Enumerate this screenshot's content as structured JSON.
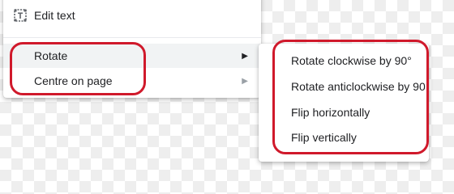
{
  "context_menu": {
    "edit_text_label": "Edit text",
    "edit_text_icon": "text-box-icon",
    "rotate_label": "Rotate",
    "centre_label": "Centre on page",
    "submenu_arrow": "▶"
  },
  "rotate_submenu": {
    "items": [
      {
        "label": "Rotate clockwise by 90°"
      },
      {
        "label": "Rotate anticlockwise by 90"
      },
      {
        "label": "Flip horizontally"
      },
      {
        "label": "Flip vertically"
      }
    ]
  },
  "colors": {
    "highlight": "#d0192b",
    "hover_row": "#f1f3f4",
    "text": "#202124"
  }
}
